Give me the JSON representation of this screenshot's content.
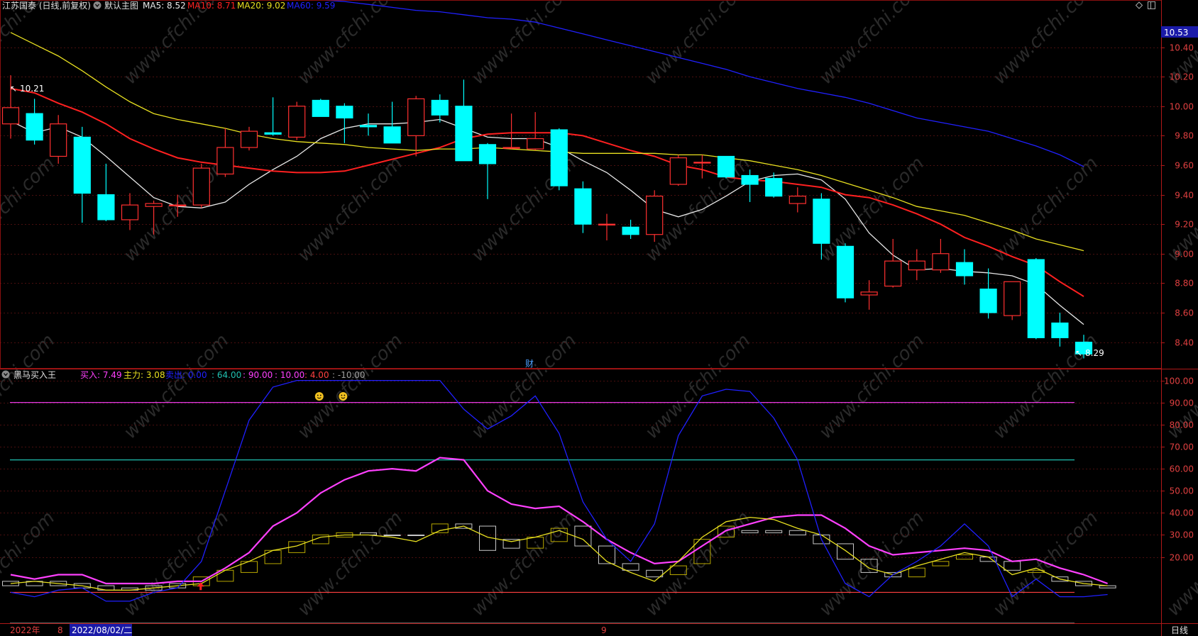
{
  "header": {
    "title": "江苏国泰 (日线,前复权)",
    "main_label": "默认主图",
    "ma5": {
      "label": "MA5: 8.52",
      "color": "#e8e8e8"
    },
    "ma10": {
      "label": "MA10: 8.71",
      "color": "#ff2020"
    },
    "ma20": {
      "label": "MA20: 9.02",
      "color": "#e8e020"
    },
    "ma60": {
      "label": "MA60: 9.59",
      "color": "#2020ff"
    }
  },
  "sub_header": {
    "name": "黑马买入王",
    "buy": {
      "label": "买入: 7.49",
      "color": "#ff40ff"
    },
    "main": {
      "label": "主力: 3.08",
      "color": "#e8e020"
    },
    "sell": {
      "label": "卖出: 0.00",
      "color": "#2020ff"
    },
    "consts": [
      ": 64.00",
      ": 90.00",
      ": 10.00",
      ": 4.00",
      ": -10.00"
    ],
    "const_colors": [
      "#20c0b0",
      "#ff40ff",
      "#ff40ff",
      "#ff4040",
      "#a0a0a0"
    ]
  },
  "price_tag": "10.53",
  "annotations": {
    "high": "10.21",
    "low": "8.29",
    "cai": "财"
  },
  "bottom": {
    "year": "2022年",
    "month8": "8",
    "date": "2022/08/02/二",
    "month9": "9",
    "period": "日线"
  },
  "top_icons": [
    "diamond-icon",
    "window-icon"
  ],
  "chart_data": [
    {
      "type": "candlestick",
      "title": "江苏国泰 (日线,前复权)",
      "ylim": [
        8.22,
        10.72
      ],
      "yticks": [
        10.4,
        10.2,
        10.0,
        9.8,
        9.6,
        9.4,
        9.2,
        9.0,
        8.8,
        8.6,
        8.4
      ],
      "up_color": "#ff3030",
      "down_color": "#00ffff",
      "candles": [
        {
          "o": 9.88,
          "h": 10.21,
          "l": 9.78,
          "c": 9.99
        },
        {
          "o": 9.95,
          "h": 10.05,
          "l": 9.74,
          "c": 9.77
        },
        {
          "o": 9.66,
          "h": 9.94,
          "l": 9.61,
          "c": 9.88
        },
        {
          "o": 9.79,
          "h": 9.86,
          "l": 9.21,
          "c": 9.41
        },
        {
          "o": 9.4,
          "h": 9.61,
          "l": 9.22,
          "c": 9.23
        },
        {
          "o": 9.23,
          "h": 9.41,
          "l": 9.16,
          "c": 9.33
        },
        {
          "o": 9.32,
          "h": 9.36,
          "l": 9.13,
          "c": 9.34
        },
        {
          "o": 9.33,
          "h": 9.4,
          "l": 9.25,
          "c": 9.33
        },
        {
          "o": 9.33,
          "h": 9.61,
          "l": 9.31,
          "c": 9.58
        },
        {
          "o": 9.54,
          "h": 9.85,
          "l": 9.52,
          "c": 9.72
        },
        {
          "o": 9.72,
          "h": 9.86,
          "l": 9.7,
          "c": 9.83
        },
        {
          "o": 9.82,
          "h": 10.06,
          "l": 9.8,
          "c": 9.81
        },
        {
          "o": 9.79,
          "h": 10.03,
          "l": 9.77,
          "c": 10.0
        },
        {
          "o": 10.04,
          "h": 10.05,
          "l": 9.93,
          "c": 9.93
        },
        {
          "o": 10.0,
          "h": 10.02,
          "l": 9.75,
          "c": 9.92
        },
        {
          "o": 9.87,
          "h": 9.95,
          "l": 9.8,
          "c": 9.86
        },
        {
          "o": 9.86,
          "h": 10.03,
          "l": 9.76,
          "c": 9.75
        },
        {
          "o": 9.8,
          "h": 10.07,
          "l": 9.66,
          "c": 10.05
        },
        {
          "o": 10.04,
          "h": 10.08,
          "l": 9.89,
          "c": 9.94
        },
        {
          "o": 10.0,
          "h": 10.18,
          "l": 9.86,
          "c": 9.63
        },
        {
          "o": 9.74,
          "h": 9.75,
          "l": 9.37,
          "c": 9.61
        },
        {
          "o": 9.72,
          "h": 9.95,
          "l": 9.71,
          "c": 9.72
        },
        {
          "o": 9.71,
          "h": 9.96,
          "l": 9.7,
          "c": 9.78
        },
        {
          "o": 9.84,
          "h": 9.85,
          "l": 9.43,
          "c": 9.46
        },
        {
          "o": 9.44,
          "h": 9.49,
          "l": 9.14,
          "c": 9.2
        },
        {
          "o": 9.2,
          "h": 9.27,
          "l": 9.09,
          "c": 9.2
        },
        {
          "o": 9.18,
          "h": 9.23,
          "l": 9.1,
          "c": 9.13
        },
        {
          "o": 9.13,
          "h": 9.43,
          "l": 9.08,
          "c": 9.39
        },
        {
          "o": 9.47,
          "h": 9.67,
          "l": 9.46,
          "c": 9.65
        },
        {
          "o": 9.62,
          "h": 9.67,
          "l": 9.51,
          "c": 9.62
        },
        {
          "o": 9.66,
          "h": 9.66,
          "l": 9.51,
          "c": 9.52
        },
        {
          "o": 9.53,
          "h": 9.57,
          "l": 9.35,
          "c": 9.47
        },
        {
          "o": 9.51,
          "h": 9.55,
          "l": 9.38,
          "c": 9.39
        },
        {
          "o": 9.34,
          "h": 9.45,
          "l": 9.28,
          "c": 9.39
        },
        {
          "o": 9.37,
          "h": 9.41,
          "l": 8.96,
          "c": 9.07
        },
        {
          "o": 9.05,
          "h": 9.07,
          "l": 8.67,
          "c": 8.7
        },
        {
          "o": 8.72,
          "h": 8.82,
          "l": 8.62,
          "c": 8.74
        },
        {
          "o": 8.78,
          "h": 9.1,
          "l": 8.77,
          "c": 8.95
        },
        {
          "o": 8.89,
          "h": 9.03,
          "l": 8.82,
          "c": 8.95
        },
        {
          "o": 8.89,
          "h": 9.1,
          "l": 8.87,
          "c": 9.0
        },
        {
          "o": 8.94,
          "h": 9.03,
          "l": 8.79,
          "c": 8.85
        },
        {
          "o": 8.76,
          "h": 8.9,
          "l": 8.56,
          "c": 8.6
        },
        {
          "o": 8.58,
          "h": 8.81,
          "l": 8.55,
          "c": 8.81
        },
        {
          "o": 8.96,
          "h": 8.97,
          "l": 8.42,
          "c": 8.43
        },
        {
          "o": 8.53,
          "h": 8.6,
          "l": 8.37,
          "c": 8.43
        },
        {
          "o": 8.4,
          "h": 8.45,
          "l": 8.29,
          "c": 8.32
        }
      ],
      "series": [
        {
          "name": "MA5",
          "color": "#e8e8e8",
          "values": [
            9.9,
            9.82,
            9.86,
            9.79,
            9.66,
            9.52,
            9.38,
            9.32,
            9.31,
            9.35,
            9.47,
            9.57,
            9.66,
            9.78,
            9.85,
            9.88,
            9.88,
            9.89,
            9.91,
            9.85,
            9.79,
            9.78,
            9.78,
            9.72,
            9.63,
            9.55,
            9.43,
            9.3,
            9.25,
            9.3,
            9.39,
            9.49,
            9.53,
            9.54,
            9.5,
            9.37,
            9.14,
            8.99,
            8.89,
            8.9,
            8.88,
            8.87,
            8.85,
            8.79,
            8.65,
            8.52
          ]
        },
        {
          "name": "MA10",
          "color": "#ff2020",
          "values": [
            10.12,
            10.09,
            10.02,
            9.96,
            9.88,
            9.78,
            9.71,
            9.65,
            9.62,
            9.6,
            9.58,
            9.56,
            9.55,
            9.55,
            9.56,
            9.6,
            9.64,
            9.68,
            9.72,
            9.78,
            9.81,
            9.82,
            9.82,
            9.82,
            9.8,
            9.75,
            9.7,
            9.66,
            9.6,
            9.57,
            9.52,
            9.5,
            9.49,
            9.47,
            9.45,
            9.4,
            9.38,
            9.33,
            9.27,
            9.2,
            9.11,
            9.05,
            8.98,
            8.92,
            8.81,
            8.71
          ]
        },
        {
          "name": "MA20",
          "color": "#e8e020",
          "values": [
            10.5,
            10.42,
            10.34,
            10.24,
            10.13,
            10.03,
            9.95,
            9.91,
            9.88,
            9.85,
            9.81,
            9.78,
            9.76,
            9.75,
            9.74,
            9.72,
            9.71,
            9.7,
            9.71,
            9.71,
            9.72,
            9.71,
            9.7,
            9.69,
            9.68,
            9.68,
            9.68,
            9.68,
            9.67,
            9.67,
            9.65,
            9.63,
            9.6,
            9.57,
            9.53,
            9.48,
            9.43,
            9.38,
            9.32,
            9.29,
            9.26,
            9.21,
            9.16,
            9.1,
            9.06,
            9.02
          ]
        },
        {
          "name": "MA60",
          "color": "#2020ff",
          "values": [
            10.89,
            10.88,
            10.87,
            10.86,
            10.86,
            10.85,
            10.84,
            10.83,
            10.81,
            10.8,
            10.78,
            10.76,
            10.74,
            10.72,
            10.71,
            10.69,
            10.67,
            10.65,
            10.64,
            10.62,
            10.6,
            10.59,
            10.57,
            10.53,
            10.49,
            10.45,
            10.41,
            10.37,
            10.33,
            10.29,
            10.25,
            10.2,
            10.16,
            10.12,
            10.09,
            10.06,
            10.02,
            9.97,
            9.92,
            9.89,
            9.86,
            9.83,
            9.78,
            9.73,
            9.67,
            9.59
          ]
        }
      ]
    },
    {
      "type": "line",
      "title": "黑马买入王",
      "ylim": [
        -10,
        105
      ],
      "yticks": [
        100.0,
        90.0,
        80.0,
        70.0,
        60.0,
        50.0,
        40.0,
        30.0,
        20.0
      ],
      "constants": [
        {
          "value": 90,
          "color": "#ff40ff"
        },
        {
          "value": 64,
          "color": "#20c0b0"
        },
        {
          "value": 4,
          "color": "#ff4040"
        },
        {
          "value": -10,
          "color": "#a0a0a0"
        }
      ],
      "series": [
        {
          "name": "买入",
          "color": "#ff40ff",
          "values": [
            12,
            10,
            12,
            12,
            8,
            8,
            8,
            9,
            9,
            15,
            22,
            34,
            40,
            49,
            55,
            59,
            60,
            59,
            65,
            64,
            50,
            44,
            42,
            43,
            36,
            28,
            22,
            17,
            18,
            25,
            32,
            35,
            38,
            39,
            39,
            33,
            25,
            21,
            22,
            23,
            24,
            23,
            18,
            19,
            15,
            12,
            8
          ]
        },
        {
          "name": "主力",
          "color": "#e8e020",
          "values": [
            8,
            9,
            8,
            7,
            5,
            5,
            6,
            7,
            8,
            14,
            18,
            23,
            25,
            29,
            30,
            30,
            29,
            27,
            32,
            34,
            29,
            27,
            29,
            32,
            28,
            18,
            13,
            9,
            18,
            29,
            36,
            38,
            37,
            33,
            30,
            23,
            15,
            12,
            16,
            19,
            22,
            20,
            12,
            15,
            10,
            8,
            7
          ]
        },
        {
          "name": "卖出",
          "color": "#2020ff",
          "values": [
            4,
            2,
            5,
            6,
            0,
            0,
            4,
            6,
            18,
            50,
            82,
            97,
            100,
            100,
            100,
            100,
            100,
            100,
            100,
            87,
            78,
            84,
            93,
            76,
            45,
            28,
            18,
            35,
            75,
            93,
            96,
            95,
            83,
            64,
            28,
            8,
            2,
            12,
            18,
            25,
            35,
            25,
            2,
            10,
            2,
            2,
            3
          ]
        }
      ],
      "boxes": [
        {
          "top": 9,
          "bottom": 7,
          "dir": "down"
        },
        {
          "top": 9,
          "bottom": 7,
          "dir": "down"
        },
        {
          "top": 9,
          "bottom": 7,
          "dir": "down"
        },
        {
          "top": 8,
          "bottom": 6,
          "dir": "down"
        },
        {
          "top": 7,
          "bottom": 5,
          "dir": "down"
        },
        {
          "top": 6,
          "bottom": 5,
          "dir": "down"
        },
        {
          "top": 7,
          "bottom": 5,
          "dir": "down"
        },
        {
          "top": 8,
          "bottom": 6,
          "dir": "down"
        },
        {
          "top": 11,
          "bottom": 7,
          "dir": "up"
        },
        {
          "top": 14,
          "bottom": 9,
          "dir": "up"
        },
        {
          "top": 18,
          "bottom": 13,
          "dir": "up"
        },
        {
          "top": 23,
          "bottom": 17,
          "dir": "up"
        },
        {
          "top": 27,
          "bottom": 22,
          "dir": "up"
        },
        {
          "top": 30,
          "bottom": 26,
          "dir": "up"
        },
        {
          "top": 31,
          "bottom": 29,
          "dir": "up"
        },
        {
          "top": 31,
          "bottom": 30,
          "dir": "down"
        },
        {
          "top": 30,
          "bottom": 30,
          "dir": "down"
        },
        {
          "top": 30,
          "bottom": 30,
          "dir": "down"
        },
        {
          "top": 35,
          "bottom": 31,
          "dir": "up"
        },
        {
          "top": 35,
          "bottom": 33,
          "dir": "down"
        },
        {
          "top": 34,
          "bottom": 23,
          "dir": "down"
        },
        {
          "top": 28,
          "bottom": 24,
          "dir": "down"
        },
        {
          "top": 29,
          "bottom": 24,
          "dir": "up"
        },
        {
          "top": 33,
          "bottom": 27,
          "dir": "up"
        },
        {
          "top": 34,
          "bottom": 25,
          "dir": "down"
        },
        {
          "top": 25,
          "bottom": 17,
          "dir": "down"
        },
        {
          "top": 17,
          "bottom": 14,
          "dir": "down"
        },
        {
          "top": 14,
          "bottom": 11,
          "dir": "down"
        },
        {
          "top": 16,
          "bottom": 12,
          "dir": "up"
        },
        {
          "top": 28,
          "bottom": 17,
          "dir": "up"
        },
        {
          "top": 34,
          "bottom": 29,
          "dir": "up"
        },
        {
          "top": 32,
          "bottom": 31,
          "dir": "down"
        },
        {
          "top": 32,
          "bottom": 31,
          "dir": "down"
        },
        {
          "top": 32,
          "bottom": 30,
          "dir": "down"
        },
        {
          "top": 30,
          "bottom": 26,
          "dir": "down"
        },
        {
          "top": 26,
          "bottom": 19,
          "dir": "down"
        },
        {
          "top": 19,
          "bottom": 13,
          "dir": "down"
        },
        {
          "top": 13,
          "bottom": 11,
          "dir": "down"
        },
        {
          "top": 15,
          "bottom": 11,
          "dir": "up"
        },
        {
          "top": 18,
          "bottom": 16,
          "dir": "up"
        },
        {
          "top": 21,
          "bottom": 19,
          "dir": "up"
        },
        {
          "top": 20,
          "bottom": 18,
          "dir": "down"
        },
        {
          "top": 18,
          "bottom": 14,
          "dir": "down"
        },
        {
          "top": 14,
          "bottom": 13,
          "dir": "up"
        },
        {
          "top": 11,
          "bottom": 9,
          "dir": "down"
        },
        {
          "top": 9,
          "bottom": 7,
          "dir": "down"
        },
        {
          "top": 7,
          "bottom": 6,
          "dir": "down"
        }
      ],
      "smiley_indices": [
        13,
        14
      ],
      "arrow_index": 8
    }
  ]
}
